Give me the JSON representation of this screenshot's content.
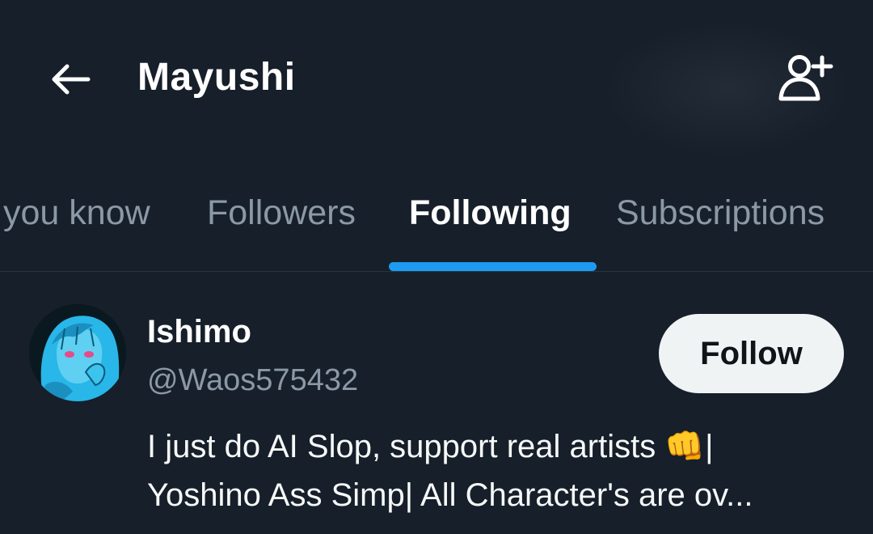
{
  "header": {
    "title": "Mayushi",
    "back_icon": "arrow-left-icon",
    "add_user_icon": "add-user-icon"
  },
  "tabs": [
    {
      "label": "you know",
      "active": false
    },
    {
      "label": "Followers",
      "active": false
    },
    {
      "label": "Following",
      "active": true
    },
    {
      "label": "Subscriptions",
      "active": false
    }
  ],
  "colors": {
    "background": "#161f2a",
    "accent": "#1d9bf0",
    "secondary_text": "#8b98a5",
    "follow_button_bg": "#eff3f4",
    "avatar_tint": "#29b6e8"
  },
  "users": [
    {
      "name": "Ishimo",
      "handle": "@Waos575432",
      "follow_label": "Follow",
      "bio_line1": "I just do AI Slop, support real artists 👊|",
      "bio_line2": "Yoshino Ass Simp| All Character's are ov..."
    }
  ]
}
